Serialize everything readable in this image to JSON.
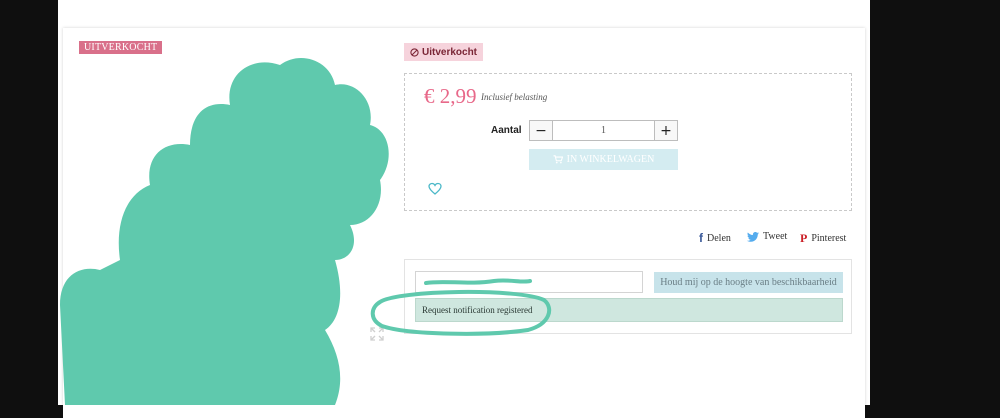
{
  "product": {
    "image_badge": "UITVERKOCHT",
    "availability_badge": "Uitverkocht",
    "price": "€ 2,99",
    "tax_note": "Inclusief belasting",
    "quantity_label": "Aantal",
    "quantity_value": "1",
    "add_to_cart_label": "IN WINKELWAGEN"
  },
  "share": {
    "facebook_label": "Delen",
    "twitter_label": "Tweet",
    "pinterest_label": "Pinterest"
  },
  "notify": {
    "button_label": "Houd mij op de hoogte van beschikbaarheid",
    "success_message": "Request notification registered"
  },
  "colors": {
    "accent_pink": "#e8698a",
    "annotation_teal": "#5fc9ad",
    "cart_button": "#d4ecf1",
    "success_bg": "#cfe7df"
  }
}
